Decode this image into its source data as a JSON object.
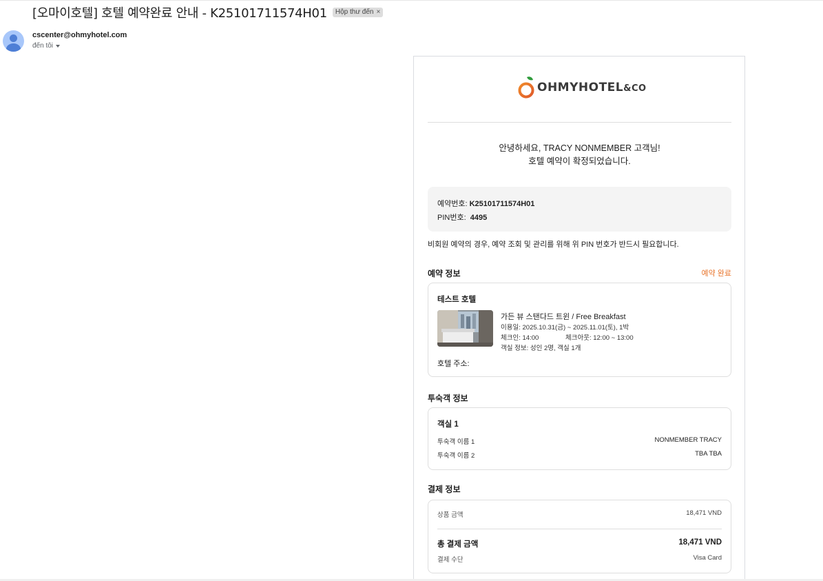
{
  "email": {
    "subject": "[오마이호텔] 호텔 예약완료 안내 - K25101711574H01",
    "label_chip": "Hộp thư đến",
    "label_chip_close": "×",
    "sender_email": "cscenter@ohmyhotel.com",
    "recipient": "đến tôi"
  },
  "brand": {
    "logo_text": "OHMYHOTEL",
    "logo_suffix": "&CO",
    "accent_color": "#e8752c",
    "logo_green": "#2e9b3a"
  },
  "greeting": {
    "line1": "안녕하세요, TRACY NONMEMBER 고객님!",
    "line2": "호텔 예약이 확정되었습니다."
  },
  "booking": {
    "number_label": "예약번호:",
    "number": "K25101711574H01",
    "pin_label": "PIN번호:",
    "pin": "4495",
    "note": "비회원 예약의 경우, 예약 조회 및 관리를 위해 위 PIN 번호가 반드시 필요합니다."
  },
  "reservation": {
    "section_title": "예약 정보",
    "status": "예약 완료",
    "hotel_name": "테스트 호텔",
    "room_title": "가든 뷰 스탠다드 트윈 / Free Breakfast",
    "stay_dates": "이용일: 2025.10.31(금) ~ 2025.11.01(토), 1박",
    "checkin": "체크인: 14:00",
    "checkout": "체크아웃: 12:00 ~ 13:00",
    "room_info": "객실 정보: 성인 2명, 객실 1개",
    "address_label": "호텔 주소:"
  },
  "guests": {
    "section_title": "투숙객 정보",
    "room_label": "객실 1",
    "rows": [
      {
        "label": "투숙객 이름 1",
        "value": "NONMEMBER TRACY"
      },
      {
        "label": "투숙객 이름 2",
        "value": "TBA TBA"
      }
    ]
  },
  "payment": {
    "section_title": "결제 정보",
    "product_label": "상품 금액",
    "product_value": "18,471 VND",
    "total_label": "총 결제 금액",
    "total_value": "18,471 VND",
    "method_label": "결제 수단",
    "method_value": "Visa Card"
  }
}
